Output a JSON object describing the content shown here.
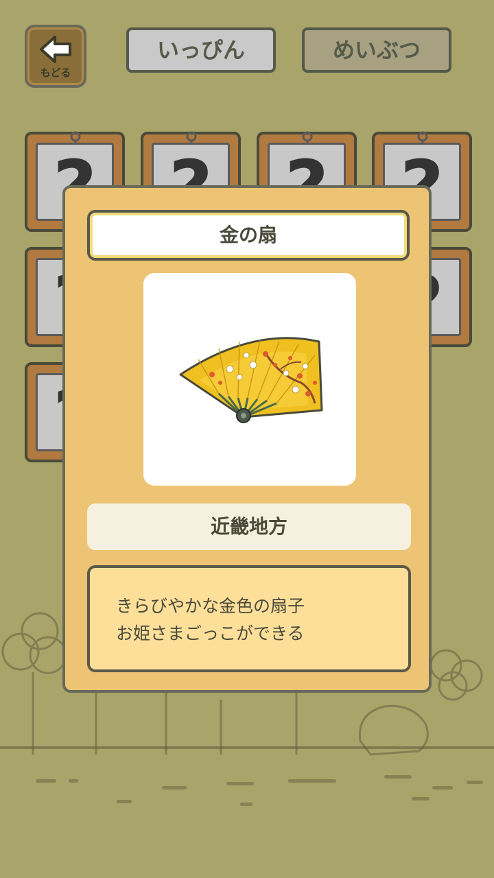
{
  "header": {
    "back_label": "もどる",
    "tabs": [
      {
        "label": "いっぴん",
        "selected": false
      },
      {
        "label": "めいぶつ",
        "selected": true
      }
    ]
  },
  "grid": {
    "placeholder": "?"
  },
  "detail": {
    "title": "金の扇",
    "image": "golden-folding-fan",
    "region": "近畿地方",
    "description_lines": [
      "きらびやかな金色の扇子",
      "お姫さまごっこができる"
    ]
  },
  "colors": {
    "background": "#a8a46a",
    "modal": "#ecc474",
    "description_box": "#fddf9a",
    "tab_selected": "#a7a081",
    "tab_unselected": "#c9c9c9"
  }
}
